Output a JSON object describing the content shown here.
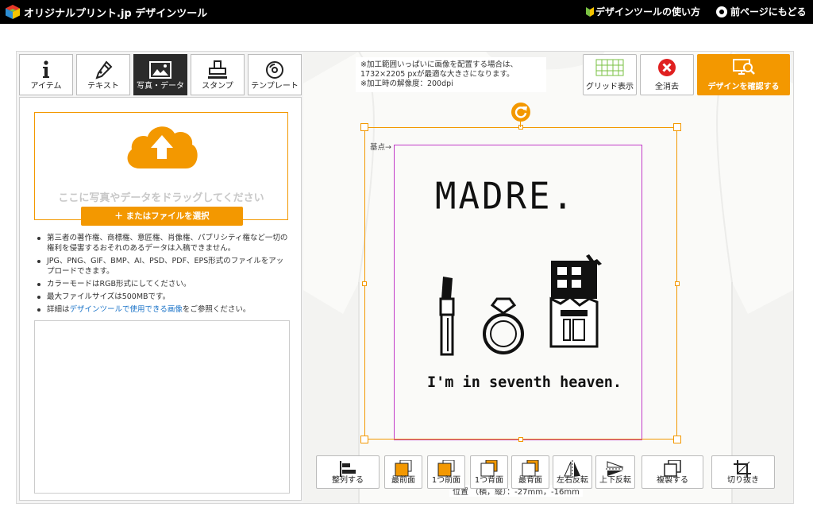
{
  "header": {
    "logo_text": "オリジナルプリント.jp デザインツール",
    "howto_label": "デザインツールの使い方",
    "back_label": "前ページにもどる"
  },
  "tabs": [
    {
      "label": "アイテム",
      "icon": "info-icon"
    },
    {
      "label": "テキスト",
      "icon": "pen-icon"
    },
    {
      "label": "写真・データ",
      "icon": "image-icon",
      "active": true
    },
    {
      "label": "スタンプ",
      "icon": "stamp-icon"
    },
    {
      "label": "テンプレート",
      "icon": "template-icon"
    }
  ],
  "upload": {
    "drop_text": "ここに写真やデータをドラッグしてください",
    "file_button": "＋ またはファイルを選択"
  },
  "notes": {
    "n1": "第三者の著作権、商標権、意匠権、肖像権、パブリシティ権など一切の権利を侵害するおそれのあるデータは入稿できません。",
    "n2": "JPG、PNG、GIF、BMP、AI、PSD、PDF、EPS形式のファイルをアップロードできます。",
    "n3": "カラーモードはRGB形式にしてください。",
    "n4": "最大ファイルサイズは500MBです。",
    "n5_prefix": "詳細は",
    "n5_link": "デザインツールで使用できる画像",
    "n5_suffix": "をご参照ください。"
  },
  "info_note": {
    "line1": "※加工範囲いっぱいに画像を配置する場合は、",
    "line2": "1732×2205 pxが最適な大きさになります。",
    "line3": "※加工時の解像度：200dpi"
  },
  "top_tools": {
    "grid": "グリッド表示",
    "clear": "全消去",
    "confirm": "デザインを確認する"
  },
  "canvas": {
    "base_label": "基点→",
    "design_title": "MADRE.",
    "design_caption": "I'm in seventh heaven.",
    "position_text": "位置 （横，縦）：-27mm，-16mm"
  },
  "bottom_tools": {
    "align": "整列する",
    "front": "最前面",
    "forward": "1つ前面",
    "backward": "1つ背面",
    "back": "最背面",
    "flip_h": "左右反転",
    "flip_v": "上下反転",
    "duplicate": "複製する",
    "crop": "切り抜き"
  },
  "colors": {
    "accent": "#f39800",
    "print_area": "#c23ac8",
    "clear_red": "#e02020"
  }
}
